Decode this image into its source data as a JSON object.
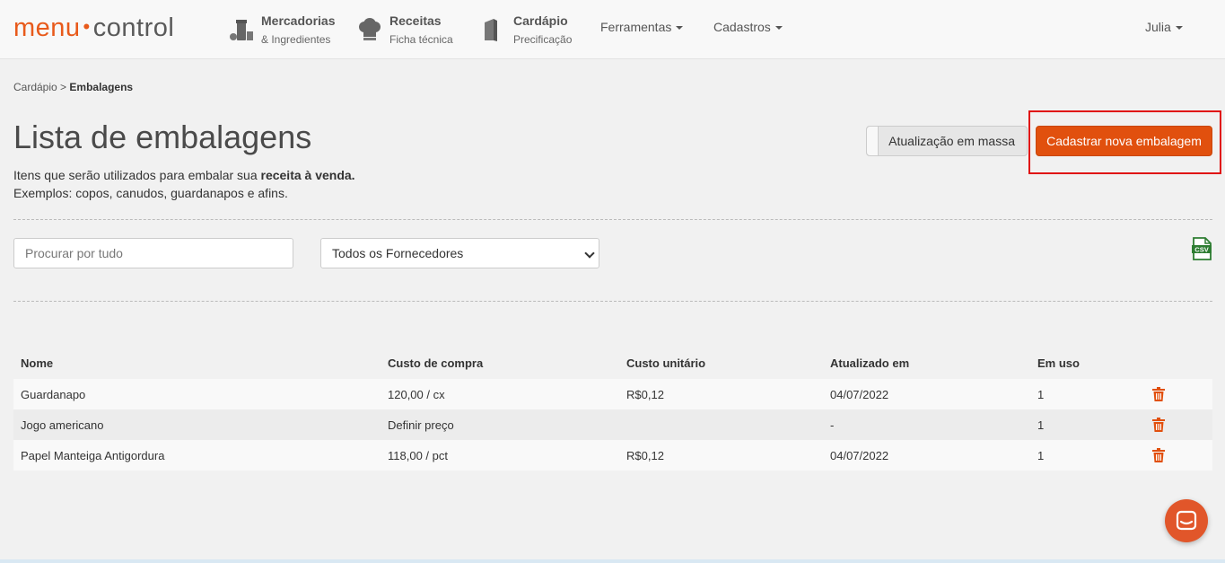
{
  "brand": {
    "part1": "menu",
    "part2": "control",
    "accent": "#e1500e"
  },
  "nav": {
    "items": [
      {
        "title": "Mercadorias",
        "subtitle": "& Ingredientes",
        "icon": "ingredients-icon"
      },
      {
        "title": "Receitas",
        "subtitle": "Ficha técnica",
        "icon": "chef-hat-icon"
      },
      {
        "title": "Cardápio",
        "subtitle": "Precificação",
        "icon": "menu-book-icon"
      }
    ],
    "dropdowns": {
      "tools": "Ferramentas",
      "registers": "Cadastros"
    },
    "user": "Julia"
  },
  "breadcrumb": {
    "parent": "Cardápio",
    "separator": ">",
    "current": "Embalagens"
  },
  "page": {
    "title": "Lista de embalagens",
    "subtitle_prefix": "Itens que serão utilizados para embalar sua ",
    "subtitle_bold": "receita à venda.",
    "subtitle_line2": "Exemplos: copos, canudos, guardanapos e afins."
  },
  "actions": {
    "mass_update": "Atualização em massa",
    "new_packaging": "Cadastrar nova embalagem"
  },
  "filters": {
    "search_placeholder": "Procurar por tudo",
    "supplier_selected": "Todos os Fornecedores",
    "export_icon": "csv-file-icon"
  },
  "table": {
    "headers": {
      "name": "Nome",
      "purchase_cost": "Custo de compra",
      "unit_cost": "Custo unitário",
      "updated_at": "Atualizado em",
      "in_use": "Em uso"
    },
    "rows": [
      {
        "name": "Guardanapo",
        "purchase_cost": "120,00 / cx",
        "unit_cost": "R$0,12",
        "updated_at": "04/07/2022",
        "in_use": "1"
      },
      {
        "name": "Jogo americano",
        "purchase_cost": "Definir preço",
        "unit_cost": "",
        "updated_at": "-",
        "in_use": "1"
      },
      {
        "name": "Papel Manteiga Antigordura",
        "purchase_cost": "118,00 / pct",
        "unit_cost": "R$0,12",
        "updated_at": "04/07/2022",
        "in_use": "1"
      }
    ]
  },
  "chat": {
    "icon": "chat-icon"
  }
}
